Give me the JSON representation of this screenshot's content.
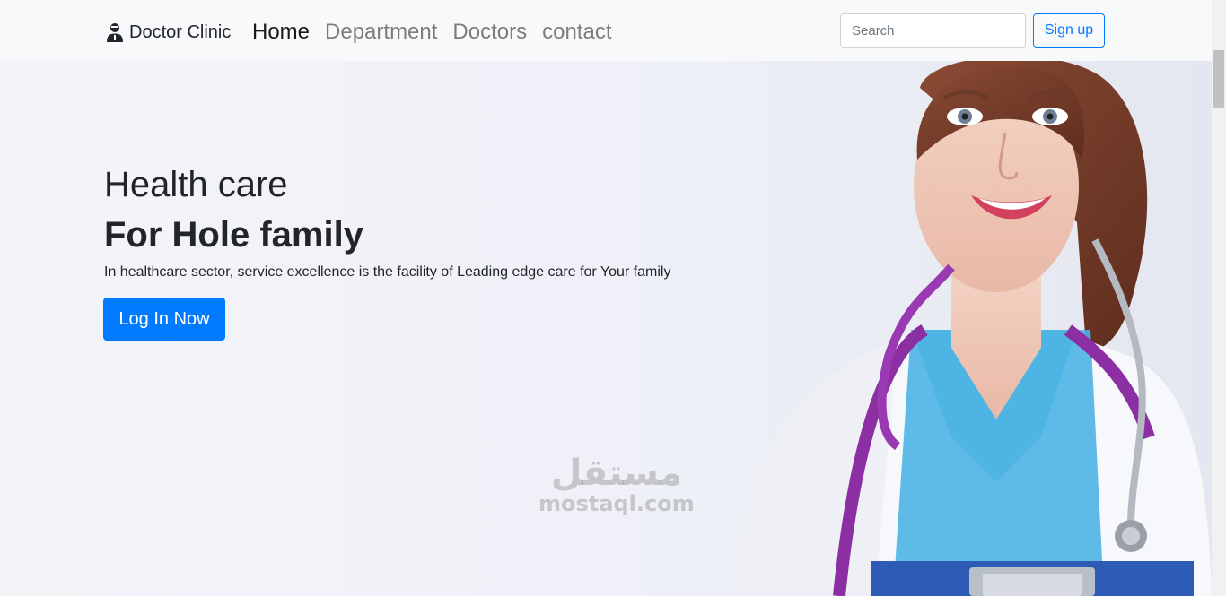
{
  "navbar": {
    "brand": "Doctor Clinic",
    "brand_icon": "doctor-icon",
    "links": [
      "Home",
      "Department",
      "Doctors",
      "contact"
    ],
    "active_link": "Home",
    "search_placeholder": "Search",
    "signup_label": "Sign up"
  },
  "hero": {
    "title": "Health care",
    "subtitle": "For Hole family",
    "text": "In healthcare sector, service excellence is the facility of Leading edge care for Your family",
    "button_label": "Log In Now"
  },
  "watermark": {
    "logo": "مستقل",
    "url": "mostaql.com"
  },
  "colors": {
    "primary": "#007bff",
    "navbar_bg": "#f8f9fa",
    "text": "#212529"
  }
}
